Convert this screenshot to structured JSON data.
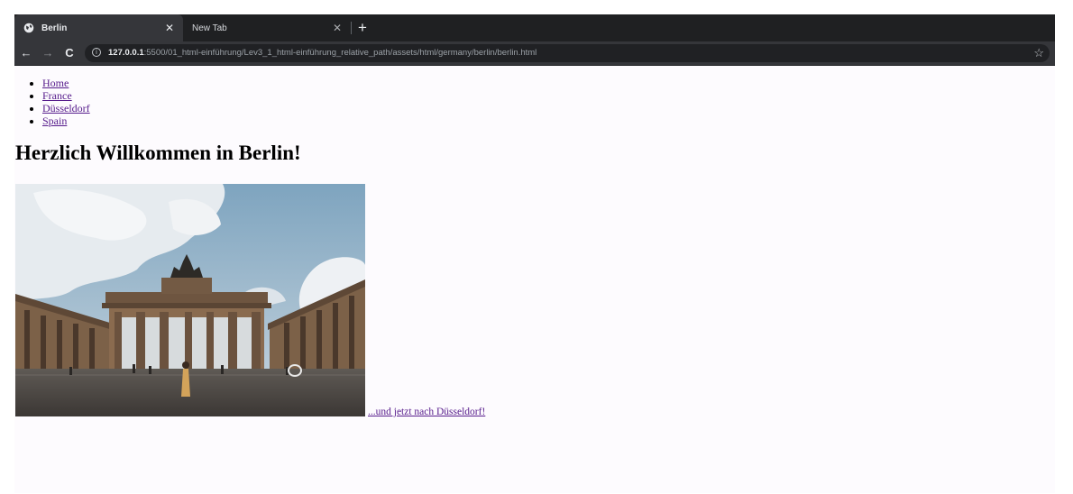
{
  "browser": {
    "tabs": [
      {
        "title": "Berlin",
        "close": "✕"
      },
      {
        "title": "New Tab",
        "close": "✕"
      }
    ],
    "new_tab": "+",
    "nav": {
      "back": "←",
      "forward": "→",
      "reload": "C"
    },
    "address": {
      "host": "127.0.0.1",
      "path": ":5500/01_html-einführung/Lev3_1_html-einführung_relative_path/assets/html/germany/berlin/berlin.html"
    },
    "bookmark_star": "☆"
  },
  "page": {
    "nav_links": [
      "Home",
      "France",
      "Düsseldorf",
      "Spain"
    ],
    "heading": "Herzlich Willkommen in Berlin!",
    "next_link": "...und jetzt nach Düsseldorf!"
  }
}
